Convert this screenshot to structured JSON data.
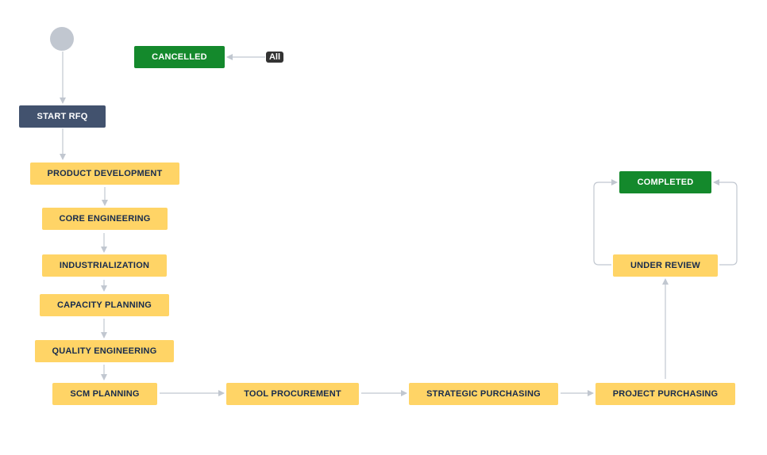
{
  "colors": {
    "to_do": "#42526e",
    "in_progress": "#ffd466",
    "done": "#14892c",
    "connector": "#c1c7d0",
    "badge": "#333333"
  },
  "global_transition": {
    "label": "All",
    "target": "cancelled"
  },
  "statuses": {
    "start_rfq": "START RFQ",
    "product_development": "PRODUCT DEVELOPMENT",
    "core_engineering": "CORE ENGINEERING",
    "industrialization": "INDUSTRIALIZATION",
    "capacity_planning": "CAPACITY PLANNING",
    "quality_engineering": "QUALITY ENGINEERING",
    "scm_planning": "SCM PLANNING",
    "tool_procurement": "TOOL PROCUREMENT",
    "strategic_purchasing": "STRATEGIC PURCHASING",
    "project_purchasing": "PROJECT PURCHASING",
    "under_review": "UNDER REVIEW",
    "completed": "COMPLETED",
    "cancelled": "CANCELLED"
  }
}
